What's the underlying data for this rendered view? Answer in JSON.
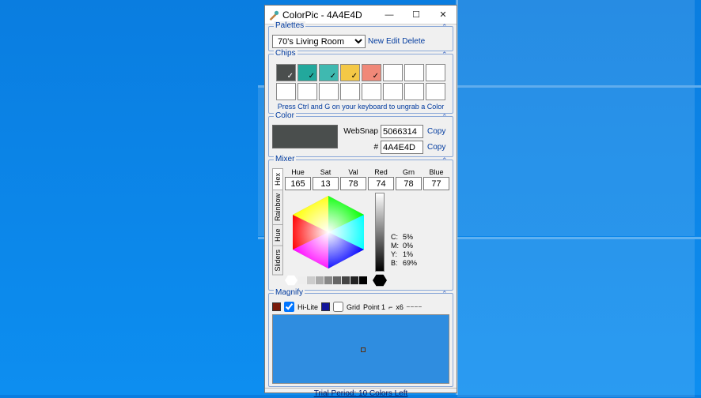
{
  "window": {
    "title": "ColorPic - 4A4E4D",
    "buttons": {
      "min": "—",
      "max": "☐",
      "close": "✕"
    }
  },
  "palettes": {
    "legend": "Palettes",
    "selected": "70's Living Room",
    "actions": {
      "new": "New",
      "edit": "Edit",
      "delete": "Delete"
    }
  },
  "chips": {
    "legend": "Chips",
    "items": [
      {
        "color": "#4A4E4D",
        "tick": true,
        "tickWhite": true
      },
      {
        "color": "#22A89C",
        "tick": true
      },
      {
        "color": "#3FB9B0",
        "tick": true
      },
      {
        "color": "#F4C846",
        "tick": true
      },
      {
        "color": "#F08878",
        "tick": true
      },
      {
        "color": "#FFFFFF",
        "tick": false
      },
      {
        "color": "#FFFFFF",
        "tick": false
      },
      {
        "color": "#FFFFFF",
        "tick": false
      },
      {
        "color": "#FFFFFF",
        "tick": false
      },
      {
        "color": "#FFFFFF",
        "tick": false
      },
      {
        "color": "#FFFFFF",
        "tick": false
      },
      {
        "color": "#FFFFFF",
        "tick": false
      },
      {
        "color": "#FFFFFF",
        "tick": false
      },
      {
        "color": "#FFFFFF",
        "tick": false
      },
      {
        "color": "#FFFFFF",
        "tick": false
      },
      {
        "color": "#FFFFFF",
        "tick": false
      }
    ],
    "hint": "Press Ctrl and G on your keyboard to ungrab a Color"
  },
  "color": {
    "legend": "Color",
    "swatch": "#4A4E4D",
    "websnap_label": "WebSnap",
    "websnap_value": "5066314",
    "hex_label": "#",
    "hex_value": "4A4E4D",
    "copy": "Copy"
  },
  "mixer": {
    "legend": "Mixer",
    "tabs": [
      "Hex",
      "Rainbow",
      "Hue",
      "Sliders"
    ],
    "labels": [
      "Hue",
      "Sat",
      "Val",
      "Red",
      "Grn",
      "Blue"
    ],
    "values": [
      "165",
      "13",
      "78",
      "74",
      "78",
      "77"
    ],
    "cmyb": {
      "C": "5%",
      "M": "0%",
      "Y": "1%",
      "B": "69%"
    }
  },
  "magnify": {
    "legend": "Magnify",
    "hilite": "Hi-Lite",
    "grid": "Grid",
    "point": "Point 1",
    "zoom": "x6",
    "hilite_color": "#7a1a0a",
    "grid_color": "#12159a"
  },
  "status": "Trial Period: 10 Colors Left"
}
